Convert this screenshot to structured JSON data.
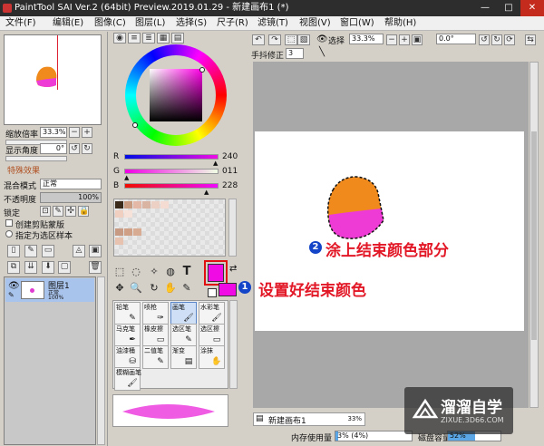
{
  "window": {
    "title": "PaintTool SAI Ver.2 (64bit) Preview.2019.01.29 - 新建画布1 (*)",
    "min": "—",
    "max": "□",
    "close": "✕"
  },
  "menu": [
    "文件(F)",
    "编辑(E)",
    "图像(C)",
    "图层(L)",
    "选择(S)",
    "尺子(R)",
    "滤镜(T)",
    "视图(V)",
    "窗口(W)",
    "帮助(H)"
  ],
  "navigator": {
    "zoom_label": "缩放倍率",
    "zoom_value": "33.3%",
    "angle_label": "显示角度",
    "angle_value": "0°"
  },
  "layer_props": {
    "effects_title": "特殊效果",
    "blend_label": "混合模式",
    "blend_value": "正常",
    "opacity_label": "不透明度",
    "opacity_value": "100%",
    "lock_label": "锁定",
    "clip_label": "创建剪贴蒙版",
    "sample_label": "指定为选区样本"
  },
  "layer": {
    "name": "图层1",
    "mode": "正常",
    "opacity": "100%"
  },
  "color_sliders": {
    "r_label": "R",
    "r_value": "240",
    "g_label": "G",
    "g_value": "011",
    "b_label": "B",
    "b_value": "228",
    "r": 240,
    "g": 11,
    "b": 228
  },
  "colors": {
    "primary": "#f00be4",
    "secondary": "#ffffff"
  },
  "brushes": [
    {
      "label": "铅笔",
      "icon": "✎"
    },
    {
      "label": "喷枪",
      "icon": "✑"
    },
    {
      "label": "画笔",
      "icon": "🖌"
    },
    {
      "label": "水彩笔",
      "icon": "🖌"
    },
    {
      "label": "马克笔",
      "icon": "✒"
    },
    {
      "label": "橡皮擦",
      "icon": "▭"
    },
    {
      "label": "选区笔",
      "icon": "✎"
    },
    {
      "label": "选区擦",
      "icon": "▭"
    },
    {
      "label": "油漆桶",
      "icon": "⛁"
    },
    {
      "label": "二值笔",
      "icon": "✎"
    },
    {
      "label": "渐变",
      "icon": "▤"
    },
    {
      "label": "涂抹",
      "icon": "✋"
    },
    {
      "label": "模糊画笔",
      "icon": "🖌"
    }
  ],
  "toolbar": {
    "select_label": "选择",
    "zoom_value": "33.3%",
    "angle_value": "0.0°",
    "stabilizer_label": "手抖修正",
    "stabilizer_value": "3"
  },
  "canvas_tab": {
    "name": "新建画布1",
    "zoom": "33%"
  },
  "statusbar": {
    "memory_label": "内存使用量",
    "memory_value": "3% (4%)",
    "disk_label": "磁盘容量",
    "disk_value": "52%"
  },
  "annotations": {
    "step1_num": "1",
    "step1_text": "设置好结束颜色",
    "step2_num": "2",
    "step2_text": "涂上结束颜色部分"
  },
  "watermark": {
    "brand": "溜溜自学",
    "url": "ZIXUE.3D66.COM"
  }
}
